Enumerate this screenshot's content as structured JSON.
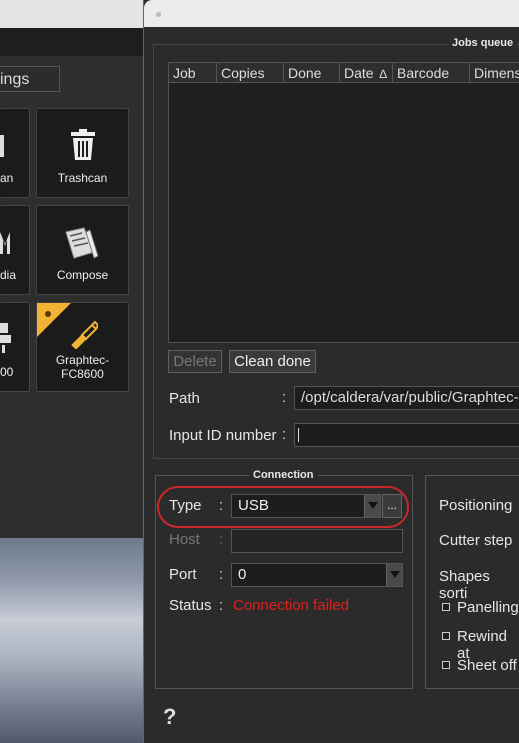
{
  "left": {
    "settings_partial": "ings",
    "tiles": [
      {
        "label": "an"
      },
      {
        "label": "Trashcan"
      },
      {
        "label": "dia"
      },
      {
        "label": "Compose"
      },
      {
        "label": "00"
      },
      {
        "label": "Graphtec-\nFC8600"
      }
    ]
  },
  "dialog": {
    "jobs_queue_title": "Jobs queue",
    "table_headers": [
      "Job",
      "Copies",
      "Done",
      "Date",
      "Barcode",
      "Dimens"
    ],
    "sort_indicator": "∆",
    "delete_label": "Delete",
    "clean_done_label": "Clean done",
    "path_label": "Path",
    "path_value": "/opt/caldera/var/public/Graphtec-F",
    "input_id_label": "Input ID number",
    "input_id_value": "",
    "connection_title": "Connection",
    "type_label": "Type",
    "type_value": "USB",
    "dots_label": "...",
    "host_label": "Host",
    "host_value": "",
    "port_label": "Port",
    "port_value": "0",
    "status_label": "Status",
    "status_value": "Connection failed",
    "status_color": "#e0201a",
    "highlight_color": "#c9282a",
    "right_items": [
      "Positioning",
      "Cutter step",
      "Shapes sorti"
    ],
    "checkboxes": [
      "Panelling",
      "Rewind at",
      "Sheet off"
    ],
    "help_label": "?"
  }
}
